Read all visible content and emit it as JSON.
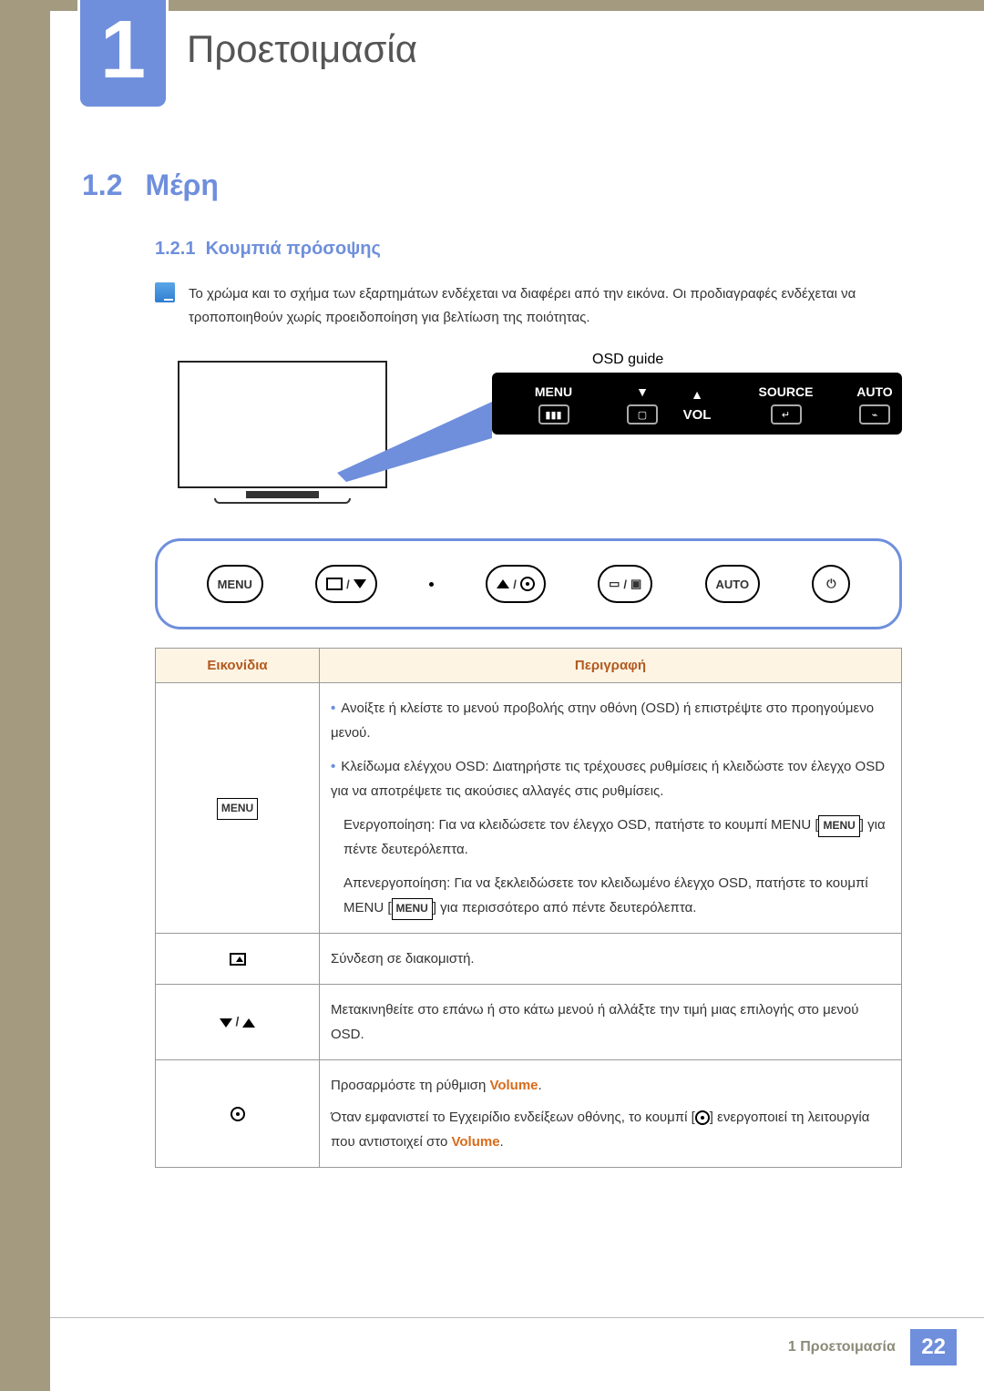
{
  "chapter": {
    "number": "1",
    "title": "Προετοιμασία"
  },
  "section": {
    "number": "1.2",
    "title": "Μέρη"
  },
  "subsection": {
    "number": "1.2.1",
    "title": "Κουμπιά πρόσοψης"
  },
  "note": "Το χρώμα και το σχήμα των εξαρτημάτων ενδέχεται να διαφέρει από την εικόνα. Οι προδιαγραφές ενδέχεται να τροποποιηθούν χωρίς προειδοποίηση για βελτίωση της ποιότητας.",
  "diagram": {
    "osd_guide_label": "OSD guide",
    "osd_bar": {
      "menu": "MENU",
      "vol": "VOL",
      "source": "SOURCE",
      "auto": "AUTO"
    },
    "panel_buttons": {
      "menu": "MENU",
      "auto": "AUTO"
    }
  },
  "table": {
    "headers": {
      "icons": "Εικονίδια",
      "description": "Περιγραφή"
    },
    "rows": [
      {
        "icon_label": "MENU",
        "bullets": [
          "Ανοίξτε ή κλείστε το μενού προβολής στην οθόνη (OSD) ή επιστρέψτε στο προηγούμενο μενού.",
          "Κλείδωμα ελέγχου OSD: Διατηρήστε τις τρέχουσες ρυθμίσεις ή κλειδώστε τον έλεγχο OSD για να αποτρέψετε τις ακούσιες αλλαγές στις ρυθμίσεις."
        ],
        "para_parts": {
          "a": "Ενεργοποίηση: Για να κλειδώσετε τον έλεγχο OSD, πατήστε το κουμπί MENU [",
          "b": "] για πέντε δευτερόλεπτα.",
          "c": "Απενεργοποίηση: Για να ξεκλειδώσετε τον κλειδωμένο έλεγχο OSD, πατήστε το κουμπί MENU [",
          "d": "] για περισσότερο από πέντε δευτερόλεπτα."
        }
      },
      {
        "icon_label": "upload_rect",
        "text": "Σύνδεση σε διακομιστή."
      },
      {
        "icon_label": "down_up",
        "text": "Μετακινηθείτε στο επάνω ή στο κάτω μενού ή αλλάξτε την τιμή μιας επιλογής στο μενού OSD."
      },
      {
        "icon_label": "dot_ring",
        "parts": {
          "a": "Προσαρμόστε τη ρύθμιση ",
          "vol1": "Volume",
          "b": ".",
          "c": "Όταν εμφανιστεί το Εγχειρίδιο ενδείξεων οθόνης, το κουμπί [",
          "d": "] ενεργοποιεί τη λειτουργία που αντιστοιχεί στο ",
          "vol2": "Volume",
          "e": "."
        }
      }
    ]
  },
  "footer": {
    "chapter_line": "1 Προετοιμασία",
    "page": "22"
  },
  "inline_labels": {
    "menu_small": "MENU"
  },
  "chart_data": null
}
